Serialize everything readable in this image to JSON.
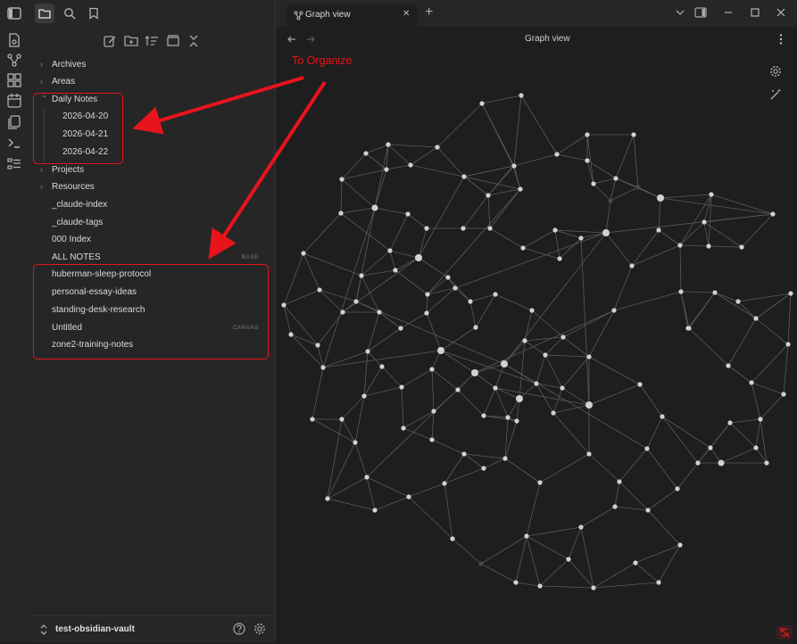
{
  "window": {
    "vault_name": "test-obsidian-vault"
  },
  "tab": {
    "title": "Graph view",
    "new_tab_symbol": "+",
    "close_symbol": "✕"
  },
  "view": {
    "title": "Graph view"
  },
  "annotation": {
    "text": "To Organize",
    "color": "#e8141c"
  },
  "file_tree": [
    {
      "label": "Archives",
      "type": "folder",
      "collapsed": true
    },
    {
      "label": "Areas",
      "type": "folder",
      "collapsed": true
    },
    {
      "label": "Daily Notes",
      "type": "folder",
      "collapsed": false
    },
    {
      "label": "2026-04-20",
      "type": "file",
      "child": true
    },
    {
      "label": "2026-04-21",
      "type": "file",
      "child": true
    },
    {
      "label": "2026-04-22",
      "type": "file",
      "child": true
    },
    {
      "label": "Projects",
      "type": "folder",
      "collapsed": true
    },
    {
      "label": "Resources",
      "type": "folder",
      "collapsed": true
    },
    {
      "label": "_claude-index",
      "type": "file"
    },
    {
      "label": "_claude-tags",
      "type": "file"
    },
    {
      "label": "000 Index",
      "type": "file"
    },
    {
      "label": "ALL NOTES",
      "type": "file",
      "tag": "BASE"
    },
    {
      "label": "huberman-sleep-protocol",
      "type": "file"
    },
    {
      "label": "personal-essay-ideas",
      "type": "file"
    },
    {
      "label": "standing-desk-research",
      "type": "file"
    },
    {
      "label": "Untitled",
      "type": "file",
      "tag": "CANVAS"
    },
    {
      "label": "zone2-training-notes",
      "type": "file"
    }
  ],
  "icons": {
    "ribbon": [
      "daily-note-icon",
      "graph-icon",
      "canvas-icon",
      "calendar-icon",
      "templates-icon",
      "terminal-icon",
      "bases-icon"
    ],
    "sidebar_tabs": [
      "folder-icon",
      "search-icon",
      "bookmark-icon"
    ],
    "file_nav": [
      "new-note-icon",
      "new-folder-icon",
      "sort-icon",
      "auto-reveal-icon",
      "collapse-all-icon"
    ]
  },
  "colors": {
    "accent_red": "#e8141c",
    "node": "#d2d2d2",
    "edge": "#5a5a5a",
    "background": "#1e1e1e"
  }
}
